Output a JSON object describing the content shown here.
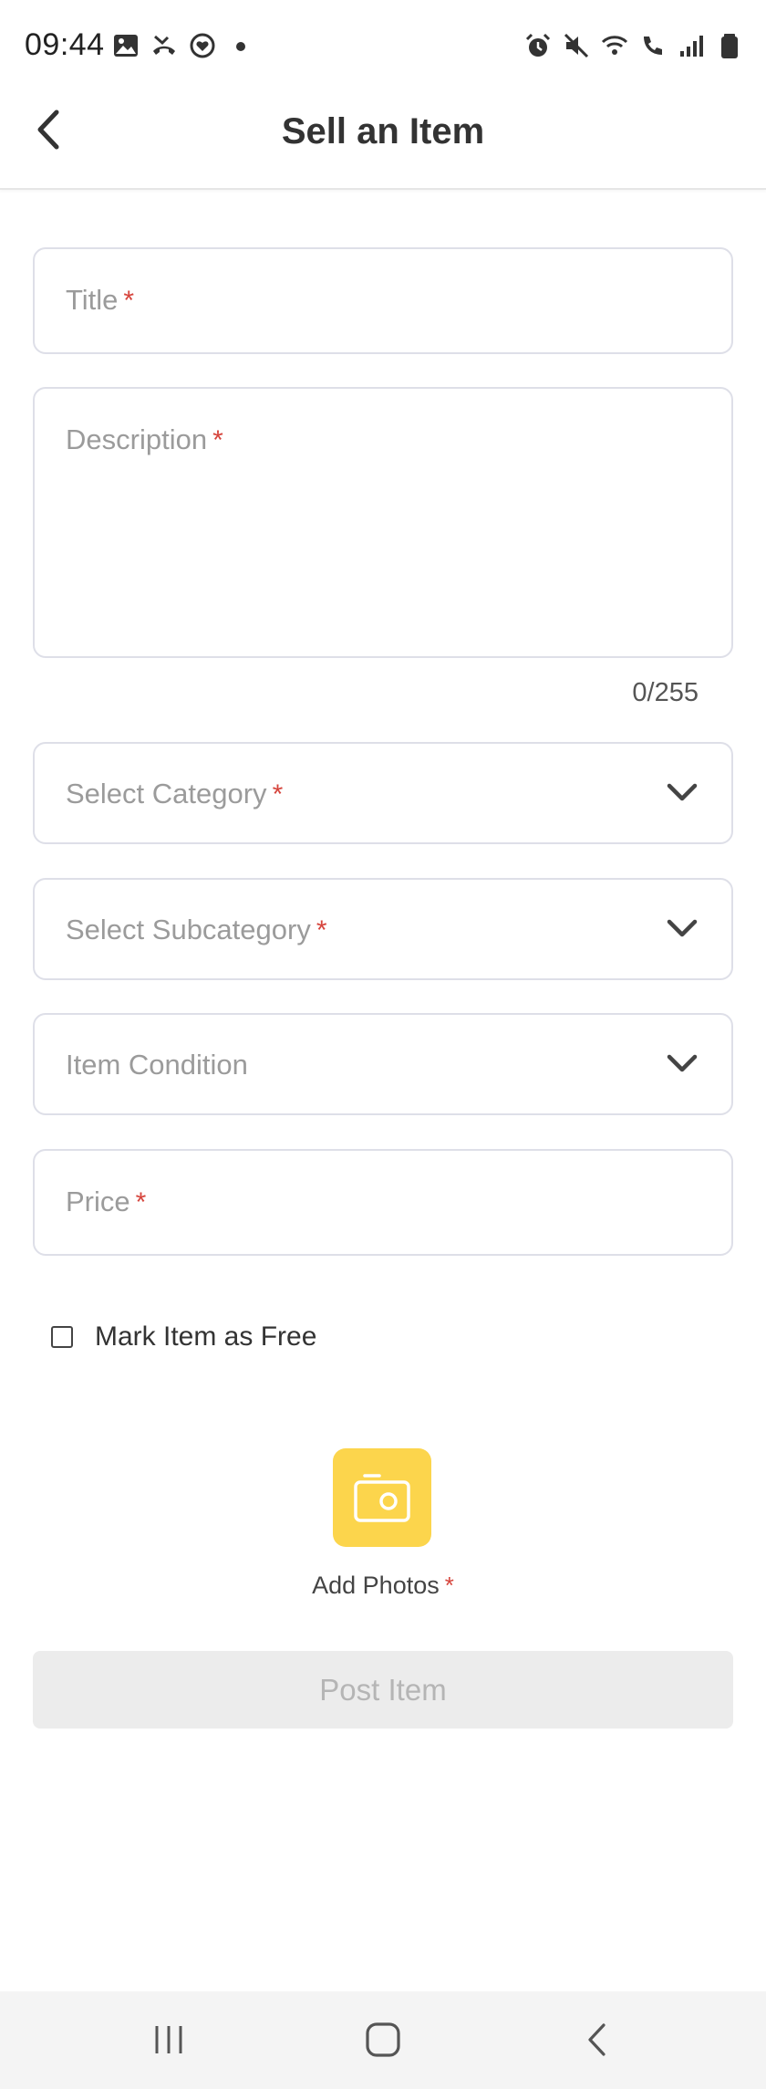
{
  "status_bar": {
    "time": "09:44",
    "left_icons": [
      "image-icon",
      "missed-call-icon",
      "heart-sync-icon",
      "dot-icon"
    ],
    "right_icons": [
      "alarm-icon",
      "mute-icon",
      "wifi-icon",
      "wifi-calling-icon",
      "signal-icon",
      "battery-icon"
    ]
  },
  "header": {
    "title": "Sell an Item",
    "back_icon": "chevron-left-icon"
  },
  "form": {
    "title_label": "Title",
    "description_label": "Description",
    "required_mark": "*",
    "description_counter": "0/255",
    "category_label": "Select Category",
    "subcategory_label": "Select Subcategory",
    "condition_label": "Item Condition",
    "price_label": "Price",
    "free_checkbox_label": "Mark Item as Free",
    "free_checked": false,
    "add_photos_label": "Add Photos",
    "post_button_label": "Post Item"
  },
  "colors": {
    "accent_yellow": "#fcd54c",
    "required_red": "#d6453d",
    "disabled_button": "#ececec"
  },
  "nav_bar": {
    "items": [
      "recent-apps-icon",
      "home-icon",
      "back-icon"
    ]
  }
}
